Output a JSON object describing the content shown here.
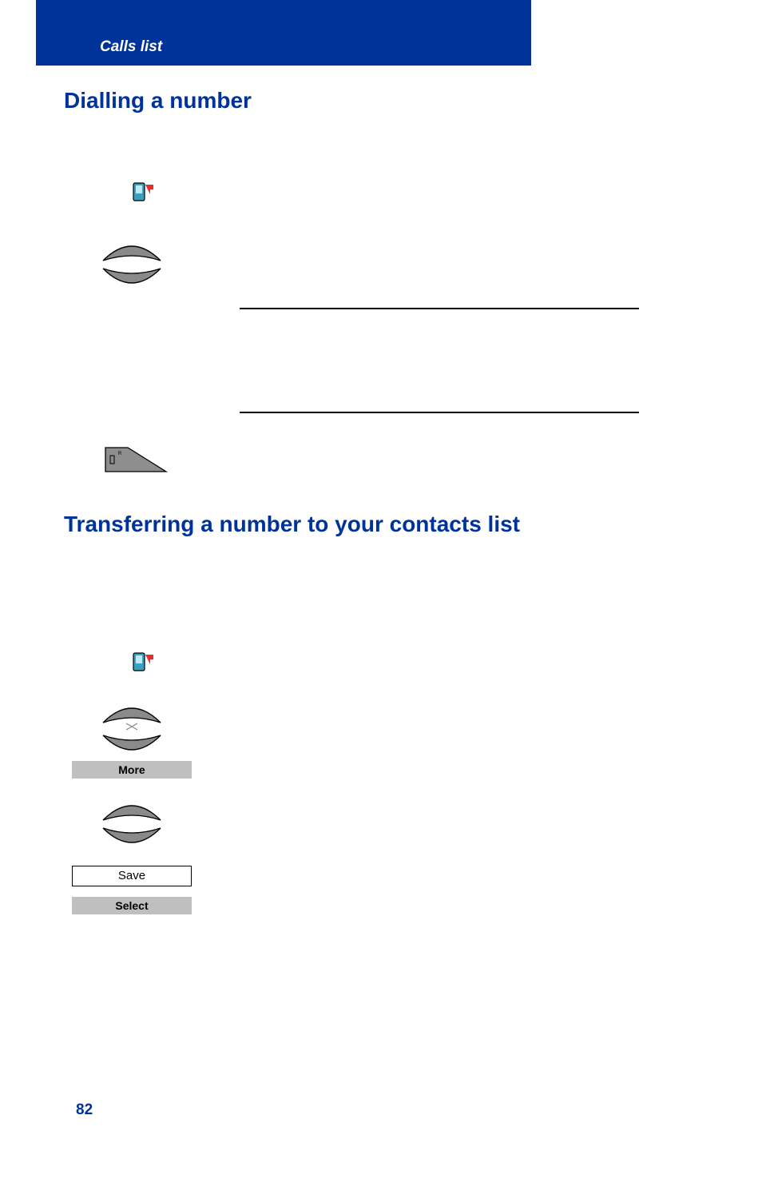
{
  "section_title": "Calls list",
  "heading_dialling": "Dialling a number",
  "heading_transferring": "Transferring a number to your contacts list",
  "buttons": {
    "more": "More",
    "save": "Save",
    "select": "Select"
  },
  "page_number": "82",
  "icons": {
    "calls_icon": "missed-calls-icon",
    "nav_arcs": "nav-up-down-icon",
    "hook_key": "recall-key-icon"
  }
}
